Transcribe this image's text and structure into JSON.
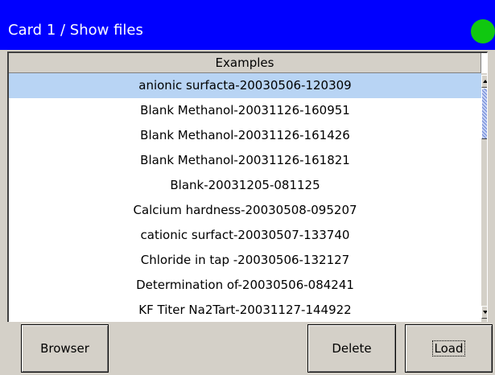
{
  "window": {
    "title": "Card 1 / Show files",
    "status_color": "#10c810",
    "status_icon": "status-dot-icon"
  },
  "file_list": {
    "header": "Examples",
    "selected_index": 0,
    "items": [
      "anionic surfacta-20030506-120309",
      "Blank Methanol-20031126-160951",
      "Blank Methanol-20031126-161426",
      "Blank Methanol-20031126-161821",
      "Blank-20031205-081125",
      "Calcium hardness-20030508-095207",
      "cationic surfact-20030507-133740",
      "Chloride in tap -20030506-132127",
      "Determination of-20030506-084241",
      "KF Titer Na2Tart-20031127-144922"
    ]
  },
  "buttons": {
    "browser": "Browser",
    "delete": "Delete",
    "load": "Load"
  }
}
